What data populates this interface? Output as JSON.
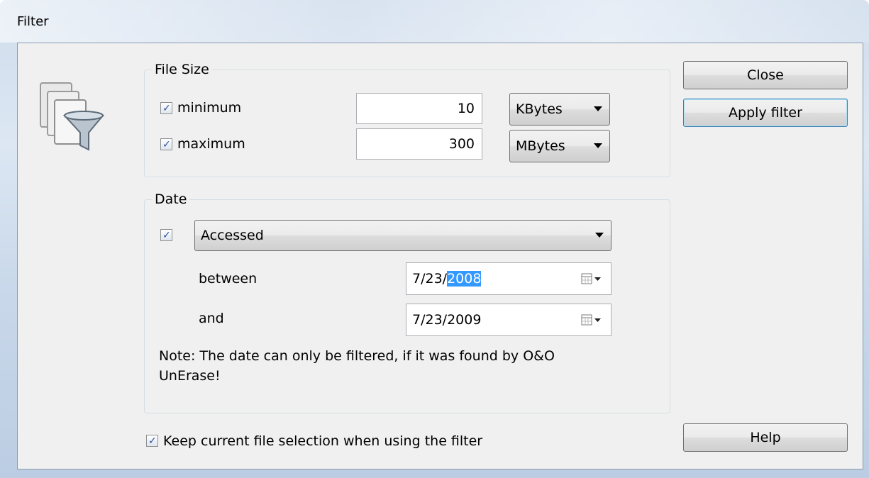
{
  "window": {
    "title": "Filter"
  },
  "file_size": {
    "group_label": "File Size",
    "minimum": {
      "label": "minimum",
      "checked": true,
      "value": "10",
      "unit": "KBytes"
    },
    "maximum": {
      "label": "maximum",
      "checked": true,
      "value": "300",
      "unit": "MBytes"
    }
  },
  "date": {
    "group_label": "Date",
    "checked": true,
    "type": "Accessed",
    "between_label": "between",
    "and_label": "and",
    "from_date_prefix": "7/23/",
    "from_date_selected": "2008",
    "to_date": "7/23/2009",
    "note": "Note: The date can only be filtered, if it was found by O&O UnErase!"
  },
  "keep_selection": {
    "label": "Keep current file selection when using the filter",
    "checked": true
  },
  "buttons": {
    "close": "Close",
    "apply": "Apply filter",
    "help": "Help"
  },
  "icons": {
    "app": "file-filter-icon",
    "calendar": "calendar-icon"
  }
}
